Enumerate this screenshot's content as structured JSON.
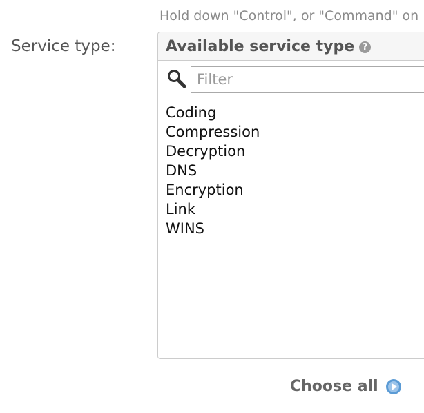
{
  "help_text": "Hold down \"Control\", or \"Command\" on",
  "field": {
    "label": "Service type:"
  },
  "selector": {
    "header_title": "Available service type",
    "help_icon_glyph": "?",
    "filter_placeholder": "Filter",
    "filter_value": "",
    "options": [
      {
        "label": "Coding"
      },
      {
        "label": "Compression"
      },
      {
        "label": "Decryption"
      },
      {
        "label": "DNS"
      },
      {
        "label": "Encryption"
      },
      {
        "label": "Link"
      },
      {
        "label": "WINS"
      }
    ],
    "choose_all_label": "Choose all"
  },
  "icons": {
    "search": "search-icon",
    "help": "help-icon",
    "choose_all": "arrow-right-circle-icon"
  },
  "colors": {
    "label_text": "#555555",
    "help_text": "#8a8a8a",
    "border": "#cccccc",
    "header_bg": "#f6f6f6",
    "accent_blue": "#5b9bd5"
  }
}
